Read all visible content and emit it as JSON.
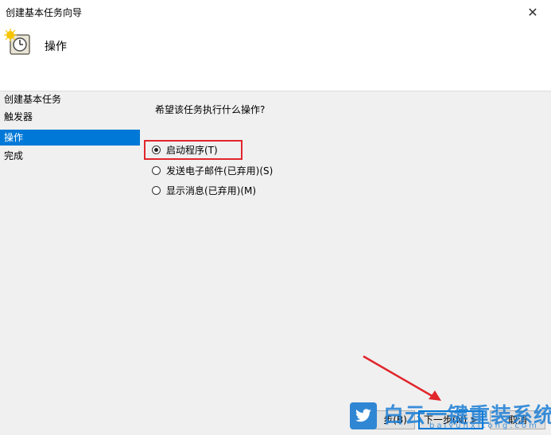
{
  "window": {
    "title": "创建基本任务向导",
    "close_glyph": "✕"
  },
  "header": {
    "title": "操作",
    "icon": "task-scheduler-clock-icon"
  },
  "sidebar": {
    "items": [
      {
        "label": "创建基本任务",
        "selected": false
      },
      {
        "label": "触发器",
        "selected": false
      },
      {
        "label": "操作",
        "selected": true
      },
      {
        "label": "完成",
        "selected": false
      }
    ]
  },
  "main": {
    "question": "希望该任务执行什么操作?",
    "options": [
      {
        "label": "启动程序(T)",
        "checked": true
      },
      {
        "label": "发送电子邮件(已弃用)(S)",
        "checked": false
      },
      {
        "label": "显示消息(已弃用)(M)",
        "checked": false
      }
    ]
  },
  "buttons": {
    "back": "步(B)",
    "next": "下一步(N) >",
    "cancel": "取消"
  },
  "watermark": {
    "text": "白云一键重装系统",
    "url": "baiyunxitong.com",
    "icon": "twitter-bird-icon"
  },
  "colors": {
    "selection": "#0078d7",
    "annotation": "#e0262b",
    "watermark": "#1c7fd6"
  }
}
